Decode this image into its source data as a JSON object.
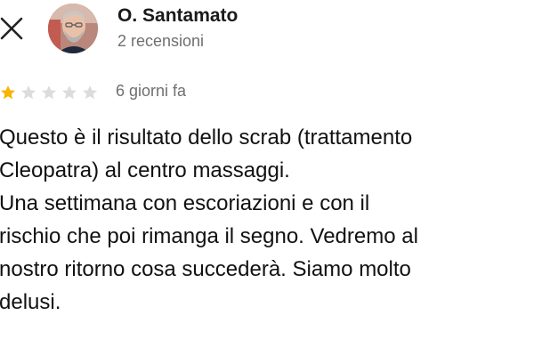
{
  "header": {
    "close_icon": "close-icon",
    "author": {
      "name": "O. Santamato",
      "meta": "2 recensioni",
      "avatar_icon": "avatar"
    }
  },
  "rating": {
    "value": 1,
    "max": 5,
    "star_filled_color": "#f7b500",
    "star_empty_color": "#dcdcdc",
    "time_ago": "6 giorni fa"
  },
  "review": {
    "lines": [
      "Questo è il risultato dello scrab (trattamento",
      "Cleopatra) al centro massaggi.",
      "Una settimana con escoriazioni e con il",
      "rischio che poi rimanga il segno. Vedremo al",
      "nostro ritorno cosa succederà. Siamo molto",
      "delusi."
    ]
  }
}
